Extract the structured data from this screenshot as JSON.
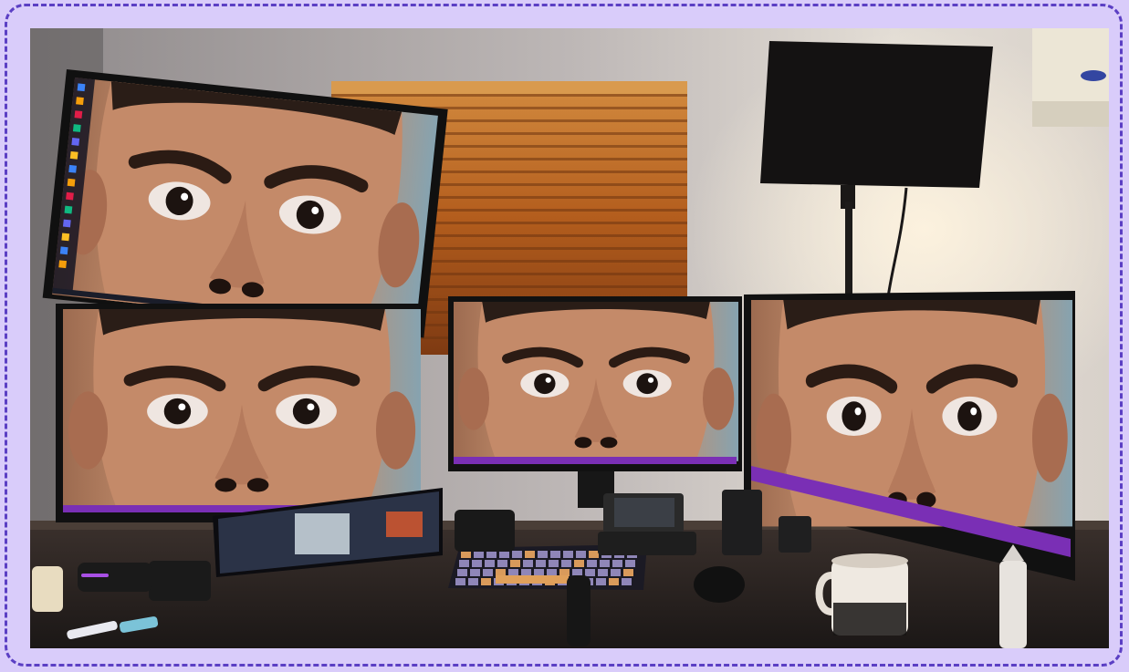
{
  "image": {
    "width": 1237,
    "height": 737
  },
  "colors": {
    "frame_fill": "#d9ccfa",
    "frame_border": "#5b3fc4",
    "wall": "#c9c3c3",
    "blinds": "#b5601d",
    "desk": "#2a2422",
    "skin": "#c99574",
    "taskbar_accent": "#7a2fb5"
  },
  "monitors": [
    {
      "id": "top-left",
      "content": "face-closeup",
      "taskbar": "desktop-icons"
    },
    {
      "id": "bottom-left",
      "content": "face-closeup"
    },
    {
      "id": "center",
      "content": "face-closeup"
    },
    {
      "id": "right",
      "content": "face-closeup"
    }
  ]
}
